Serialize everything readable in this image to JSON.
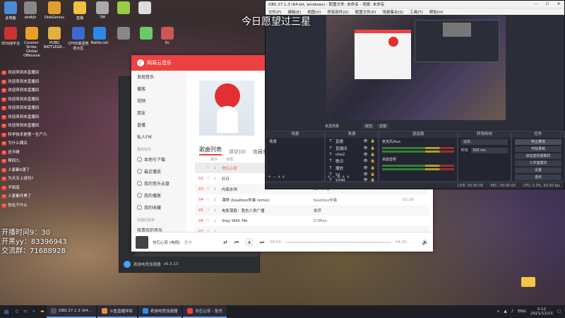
{
  "desktop_icons": [
    {
      "label": "此电脑",
      "color": "#4a8ad6"
    },
    {
      "label": "ahdkjh",
      "color": "#888"
    },
    {
      "label": "DiskGenius",
      "color": "#e0a030"
    },
    {
      "label": "直播",
      "color": "#f0c040"
    },
    {
      "label": "TM",
      "color": "#aaa"
    },
    {
      "label": "",
      "color": "#9c4"
    },
    {
      "label": "",
      "color": "#ddd"
    },
    {
      "label": "5E对战平台",
      "color": "#c33"
    },
    {
      "label": "Counter-Strike: Global Offensive",
      "color": "#e8a028"
    },
    {
      "label": "PUBG BATTLEGR...",
      "color": "#e0b040"
    },
    {
      "label": "CFHD高清竞技大区",
      "color": "#3a6ad0"
    },
    {
      "label": "Battle.net",
      "color": "#2b8ae6"
    },
    {
      "label": "",
      "color": "#888"
    },
    {
      "label": "",
      "color": "#6c6"
    },
    {
      "label": "Ec",
      "color": "#c55"
    }
  ],
  "chat": [
    {
      "nick": "",
      "msg": "欢迎来到本直播间"
    },
    {
      "nick": "",
      "msg": "欢迎来到本直播间"
    },
    {
      "nick": "",
      "msg": "欢迎来到本直播间"
    },
    {
      "nick": "",
      "msg": "欢迎来到本直播间"
    },
    {
      "nick": "",
      "msg": "欢迎来到本直播间"
    },
    {
      "nick": "",
      "msg": "欢迎来到本直播间"
    },
    {
      "nick": "",
      "msg": "欢迎来到本直播间"
    },
    {
      "nick": "",
      "msg": "科学技术是第一生产力"
    },
    {
      "nick": "",
      "msg": "为什么偶买"
    },
    {
      "nick": "",
      "msg": "还不睡"
    },
    {
      "nick": "",
      "msg": "帮四九"
    },
    {
      "nick": "",
      "msg": "人家都0落了"
    },
    {
      "nick": "",
      "msg": "为天天上班吗?"
    },
    {
      "nick": "",
      "msg": "不知道"
    },
    {
      "nick": "",
      "msg": "人家都开黑了"
    },
    {
      "nick": "",
      "msg": "你在干什么"
    }
  ],
  "overlay": {
    "title": "今日愿望过三星",
    "line1": "开播时间9：30",
    "line2": "开黑yy：83396943",
    "line3": "交流群：71688928"
  },
  "launcher": {
    "name": "奇游电竞加速器",
    "version": "v6.3.13"
  },
  "music": {
    "app_name": "网易云音乐",
    "sidebar_top": [
      "发现音乐",
      "播客",
      "视频",
      "朋友",
      "直播",
      "私人FM"
    ],
    "sidebar_section": "我的音乐",
    "sidebar_items": [
      "本地与下载",
      "最近播放",
      "我的音乐云盘",
      "我的播客",
      "我的收藏"
    ],
    "sidebar_section2": "创建的歌单",
    "sidebar_bottom": "我喜欢的音乐",
    "tabs": [
      "歌曲列表",
      "评论(0)",
      "收藏者"
    ],
    "song_header": [
      "",
      "操作",
      "标题",
      "歌手",
      "专辑",
      "时长"
    ],
    "songs": [
      {
        "no": "",
        "title": "勿忘心安",
        "artist": "张杰",
        "album": "",
        "duration": "",
        "playing": true
      },
      {
        "no": "02",
        "title": "红日",
        "artist": "",
        "album": "",
        "duration": "",
        "playing": false
      },
      {
        "no": "03",
        "title": "内面永恒",
        "artist": "Bu Feng",
        "album": "",
        "duration": "",
        "playing": false
      },
      {
        "no": "04",
        "title": "漂移 (beatbox伴奏 remix)",
        "artist": "beatbox伴奏",
        "album": "",
        "duration": "02:26",
        "playing": false
      },
      {
        "no": "05",
        "title": "电影落款：我也人类广播",
        "artist": "推荐",
        "album": "",
        "duration": "",
        "playing": false
      },
      {
        "no": "06",
        "title": "Stay With Me",
        "artist": "D.Mixx",
        "album": "",
        "duration": "",
        "playing": false
      },
      {
        "no": "07",
        "title": "",
        "artist": "",
        "album": "",
        "duration": "",
        "playing": false
      }
    ],
    "player": {
      "song": "勿忘心安 (电视)",
      "artist": "张杰",
      "elapsed": "00:00",
      "total": "04:20",
      "progress": 0.0
    }
  },
  "obs": {
    "title": "OBS 27.1.3 (64-bit, windows) - 配置文件: 未命名 - 场景: 未命名",
    "menu": [
      "文件(F)",
      "编辑(E)",
      "视图(V)",
      "停靠部件(D)",
      "配置文件(P)",
      "场景集合(S)",
      "工具(T)",
      "帮助(H)"
    ],
    "scene_bar": [
      "来选场景",
      "属性",
      "滤镜"
    ],
    "panels": {
      "scenes": {
        "title": "场景",
        "items": [
          "场景"
        ]
      },
      "sources": {
        "title": "来源",
        "items": [
          "直播",
          "直播间",
          "cba2",
          "歌词",
          "播放",
          "yy",
          "yyqq"
        ]
      },
      "mixer": {
        "title": "混音器",
        "items": [
          "麦克风/Aux",
          "桌面音频"
        ]
      },
      "transitions": {
        "title": "转场特效",
        "fade": "淡出",
        "duration_label": "时长",
        "duration": "300 ms"
      },
      "controls": {
        "title": "控件",
        "buttons": [
          "停止推流",
          "开始录制",
          "启动虚拟摄像机",
          "工作室模式",
          "设置",
          "退出"
        ]
      }
    },
    "status": [
      "LIVE: 00:00:00",
      "REC: 00:00:00",
      "CPU: 0.3%, 60.00 fps"
    ]
  },
  "taskbar": {
    "tasks": [
      {
        "label": "OBS 27.1.3 (64...",
        "color": "#555"
      },
      {
        "label": "斗鱼直播伴侣",
        "color": "#f08a3a"
      },
      {
        "label": "奇游电竞加速器",
        "color": "#3a8ae0"
      },
      {
        "label": "勿忘心安 - 张杰",
        "color": "#ec4141"
      }
    ],
    "lang": "ENG",
    "time": "0:12",
    "date": "2021/12/13"
  }
}
